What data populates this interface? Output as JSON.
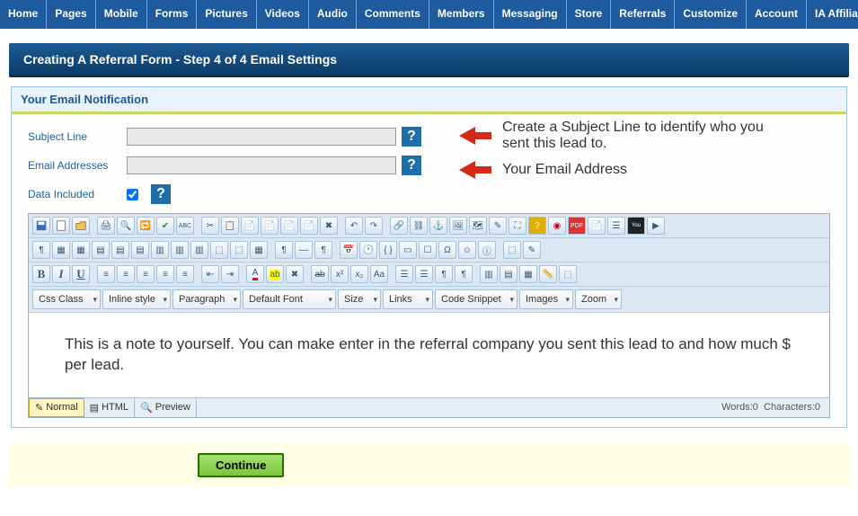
{
  "nav": [
    "Home",
    "Pages",
    "Mobile",
    "Forms",
    "Pictures",
    "Videos",
    "Audio",
    "Comments",
    "Members",
    "Messaging",
    "Store",
    "Referrals",
    "Customize",
    "Account",
    "IA Affiliate"
  ],
  "banner_title": "Creating A Referral Form - Step 4 of 4 Email Settings",
  "section_title": "Your Email Notification",
  "form": {
    "subject_label": "Subject Line",
    "addresses_label": "Email Addresses",
    "data_included_label": "Data Included",
    "subject_value": "",
    "addresses_value": "",
    "data_included_checked": true,
    "help_glyph": "?"
  },
  "annotations": {
    "subject_note": "Create a Subject Line to identify who you sent this lead to.",
    "address_note": "Your Email Address"
  },
  "editor": {
    "dropdowns": {
      "css_class": "Css Class",
      "inline_style": "Inline style",
      "paragraph": "Paragraph",
      "default_font": "Default Font",
      "size": "Size",
      "links": "Links",
      "code_snippet": "Code Snippet",
      "images": "Images",
      "zoom": "Zoom"
    },
    "content": "This is a note to yourself. You can make enter in the referral company you sent this lead to and how much $ per lead.",
    "modes": {
      "normal": "Normal",
      "html": "HTML",
      "preview": "Preview"
    },
    "status": {
      "words_label": "Words:",
      "words": 0,
      "chars_label": "Characters:",
      "chars": 0
    }
  },
  "action": {
    "continue_label": "Continue"
  },
  "icons": {
    "B": "B",
    "I": "I",
    "U": "U"
  }
}
